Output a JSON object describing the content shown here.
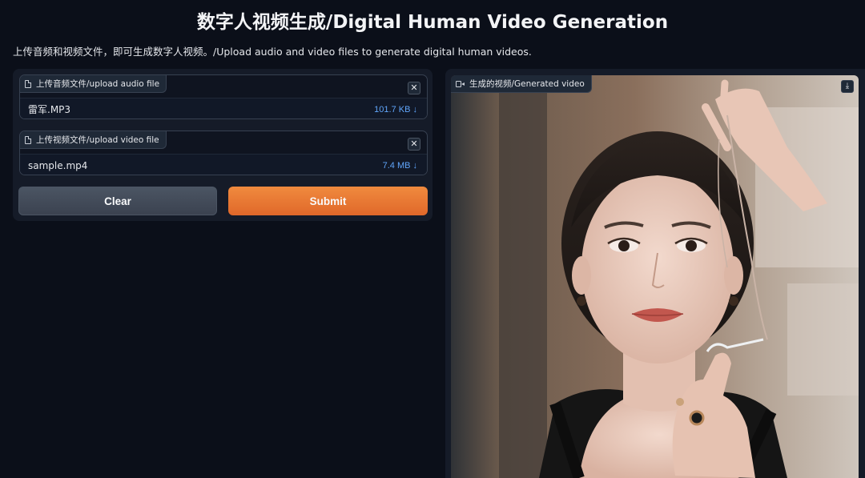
{
  "header": {
    "title": "数字人视频生成/Digital Human Video Generation",
    "subtitle": "上传音频和视频文件，即可生成数字人视频。/Upload audio and video files to generate digital human videos."
  },
  "audio_upload": {
    "label": "上传音频文件/upload audio file",
    "file_name": "雷军.MP3",
    "file_size": "101.7 KB ↓",
    "icon": "file-icon"
  },
  "video_upload": {
    "label": "上传视频文件/upload video file",
    "file_name": "sample.mp4",
    "file_size": "7.4 MB ↓",
    "icon": "file-icon"
  },
  "buttons": {
    "clear": "Clear",
    "submit": "Submit"
  },
  "output": {
    "label": "生成的视频/Generated video",
    "icon": "video-camera-icon",
    "download_icon": "download-icon"
  },
  "colors": {
    "background": "#0b0f19",
    "panel": "#151b28",
    "accent": "#e9763a",
    "file_size": "#60a5fa"
  }
}
